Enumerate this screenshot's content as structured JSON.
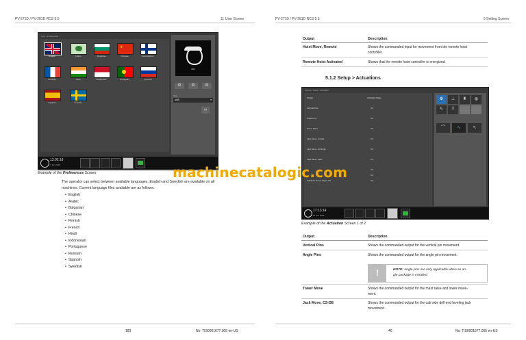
{
  "header": {
    "left_model": "PV-271D / PV-281D RCS 5.5",
    "left_section": "11 User Screen",
    "right_model": "PV-271D / PV-281D RCS 5.5",
    "right_section": "5 Setting Screen"
  },
  "left": {
    "screen": {
      "breadcrumb": "User › Preferences",
      "flags": [
        {
          "label": "English"
        },
        {
          "label": "Arabic"
        },
        {
          "label": "Bulgarian"
        },
        {
          "label": "Chinese"
        },
        {
          "label": "Suomalainen"
        },
        {
          "label": "Français"
        },
        {
          "label": "Hindi"
        },
        {
          "label": "Indonesian"
        },
        {
          "label": "Português"
        },
        {
          "label": "pусский"
        },
        {
          "label": "Español"
        },
        {
          "label": "Svenska"
        }
      ],
      "user_badge": "001",
      "user_field_label": "User",
      "user_value": "arjt5",
      "clock": "13:02:18",
      "date": "7 Jun 2018"
    },
    "caption_prefix": "Example of the ",
    "caption_bold": "Preferences",
    "caption_suffix": " Screen",
    "intro_line1": "The operator can select between available languages. English and Swedish are available on all",
    "intro_line2": "machines. Current language files available are as follows:",
    "languages": [
      "English",
      "Arabic",
      "Bulgarian",
      "Chinese",
      "Finnish",
      "French",
      "Hindi",
      "Indonesian",
      "Portuguese",
      "Russian",
      "Spanish",
      "Swedish"
    ],
    "footer_page": "183",
    "footer_doc": "No: TIS0001677.005 en-US"
  },
  "right": {
    "top_table": {
      "headers": [
        "Output",
        "Description"
      ],
      "rows": [
        {
          "output": "Hoist Move, Remote",
          "desc1": "Shows the commanded input for movement from the remote hoist",
          "desc2": "controller."
        },
        {
          "output": "Remote Hoist Activated",
          "desc1": "Shows that the remote hoist controller is energized.",
          "desc2": ""
        }
      ]
    },
    "section_title": "5.1.2 Setup > Actuations",
    "screen": {
      "breadcrumb": "Setting › Setup › Actuation",
      "col_output": "Output",
      "col_value": "Activated Value",
      "rows": [
        {
          "name": "Vertical Pins",
          "val": "0.0"
        },
        {
          "name": "Angle Pins",
          "val": "0.0"
        },
        {
          "name": "Tower Move",
          "val": "0.0"
        },
        {
          "name": "Jack Move, CS-DE",
          "val": "0.0"
        },
        {
          "name": "Jack Move, NCS-DE",
          "val": "0.0"
        },
        {
          "name": "Jack Move, NDE",
          "val": "0.0"
        },
        {
          "name": "",
          "val": "0.0"
        },
        {
          "name": "",
          "val": "0.0"
        },
        {
          "name": "Pulldown Dump Valve, CS",
          "val": "0.0"
        }
      ],
      "clock": "17:13:14",
      "date": "11 Jun 2018"
    },
    "caption_prefix": "Example of the ",
    "caption_bold": "Actuation",
    "caption_suffix": " Screen 1 of 2",
    "bottom_table": {
      "headers": [
        "Output",
        "Description"
      ],
      "rows": [
        {
          "output": "Vertical Pins",
          "desc1": "Shows the commanded output for the vertical pin movement.",
          "desc2": ""
        },
        {
          "output": "Angle Pins",
          "desc1": "Shows the commanded output for the angle pin movement.",
          "desc2": ""
        },
        {
          "output": "Tower Move",
          "desc1": "Shows the commanded output for the mast raise and lower move-",
          "desc2": "ment."
        },
        {
          "output": "Jack Move, CS-DE",
          "desc1": "Shows the commanded output for the cab side drill end leveling jack",
          "desc2": "movement."
        }
      ],
      "note_label": "NOTE:",
      "note_text1": " Angle pins are only applicable when an an-",
      "note_text2": "gle package is installed."
    },
    "footer_page": "40",
    "footer_doc": "No: TIS0001677.005 en-US"
  },
  "watermark": "machinecatalogic.com",
  "colors": {
    "accent_green": "#3cb043",
    "watermark": "#f2a900",
    "screen_bg": "#3a3a3a"
  }
}
